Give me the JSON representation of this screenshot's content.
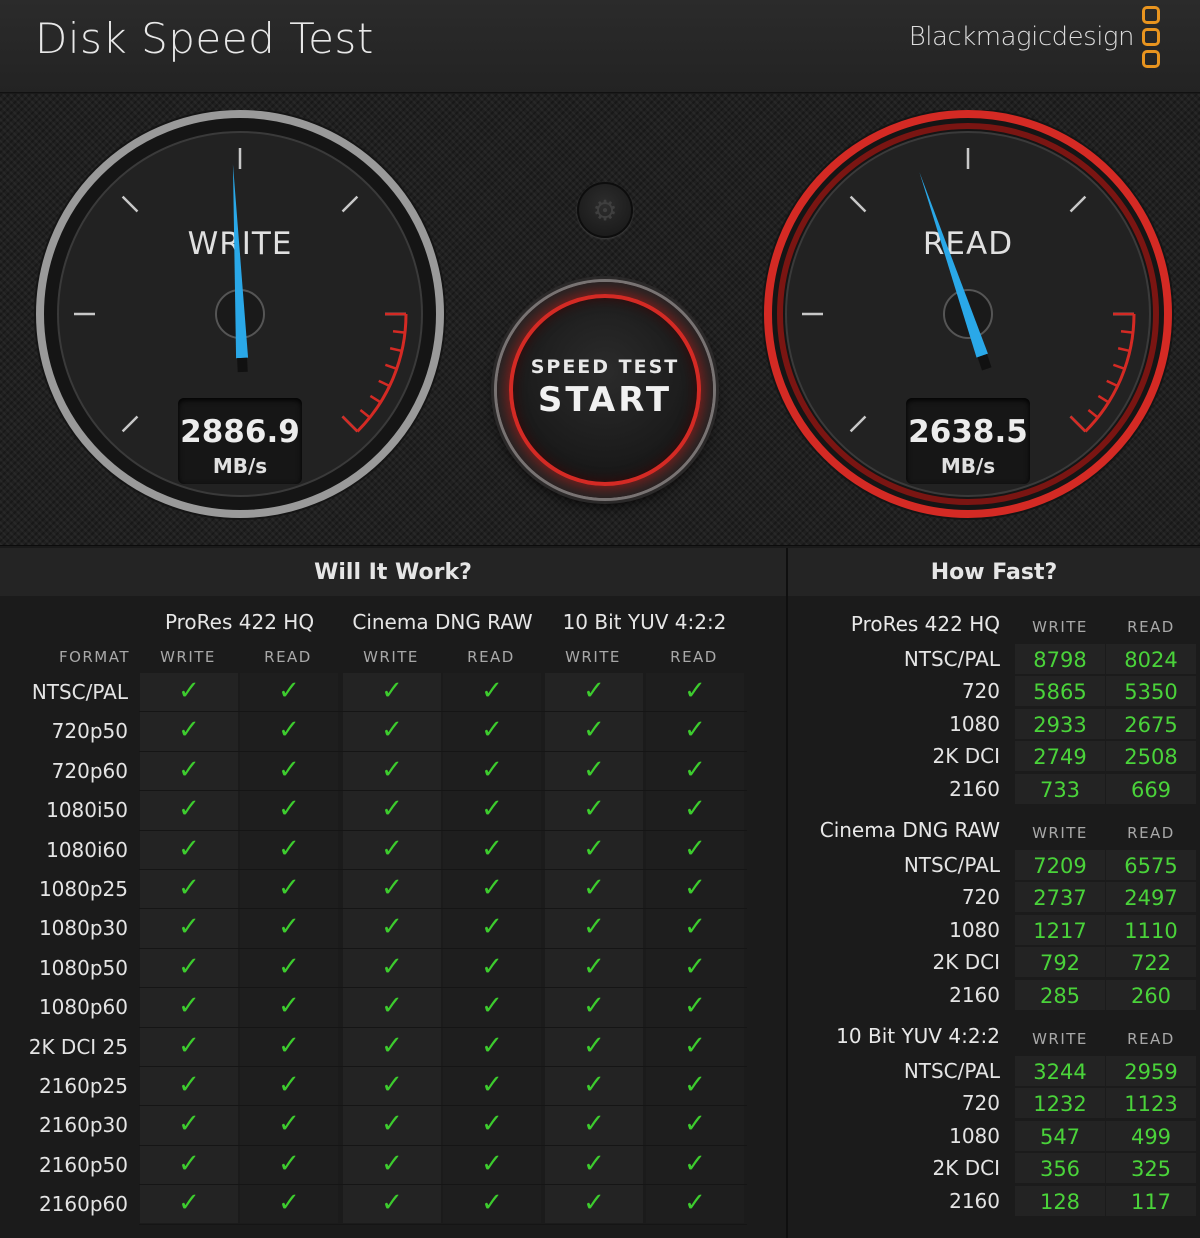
{
  "header": {
    "title": "Disk Speed Test",
    "brand": "Blackmagicdesign"
  },
  "gauges": {
    "write": {
      "label": "WRITE",
      "value": "2886.9",
      "unit": "MB/s",
      "needle_fraction": 0.49
    },
    "read": {
      "label": "READ",
      "value": "2638.5",
      "unit": "MB/s",
      "needle_fraction": 0.43
    },
    "accent_color": "#d42a24",
    "needle_color": "#2aa8e8"
  },
  "controls": {
    "settings_icon": "gear-icon",
    "start_small": "SPEED TEST",
    "start_big": "START"
  },
  "will_it_work": {
    "title": "Will It Work?",
    "format_header": "FORMAT",
    "groups": [
      {
        "name": "ProRes 422 HQ",
        "write": "WRITE",
        "read": "READ"
      },
      {
        "name": "Cinema DNG RAW",
        "write": "WRITE",
        "read": "READ"
      },
      {
        "name": "10 Bit YUV 4:2:2",
        "write": "WRITE",
        "read": "READ"
      }
    ],
    "formats": [
      "NTSC/PAL",
      "720p50",
      "720p60",
      "1080i50",
      "1080i60",
      "1080p25",
      "1080p30",
      "1080p50",
      "1080p60",
      "2K DCI 25",
      "2160p25",
      "2160p30",
      "2160p50",
      "2160p60"
    ],
    "check_mark": "✓",
    "check_color": "#3dcc2e"
  },
  "how_fast": {
    "title": "How Fast?",
    "write_header": "WRITE",
    "read_header": "READ",
    "groups": [
      {
        "name": "ProRes 422 HQ",
        "rows": [
          {
            "label": "NTSC/PAL",
            "write": "8798",
            "read": "8024"
          },
          {
            "label": "720",
            "write": "5865",
            "read": "5350"
          },
          {
            "label": "1080",
            "write": "2933",
            "read": "2675"
          },
          {
            "label": "2K DCI",
            "write": "2749",
            "read": "2508"
          },
          {
            "label": "2160",
            "write": "733",
            "read": "669"
          }
        ]
      },
      {
        "name": "Cinema DNG RAW",
        "rows": [
          {
            "label": "NTSC/PAL",
            "write": "7209",
            "read": "6575"
          },
          {
            "label": "720",
            "write": "2737",
            "read": "2497"
          },
          {
            "label": "1080",
            "write": "1217",
            "read": "1110"
          },
          {
            "label": "2K DCI",
            "write": "792",
            "read": "722"
          },
          {
            "label": "2160",
            "write": "285",
            "read": "260"
          }
        ]
      },
      {
        "name": "10 Bit YUV 4:2:2",
        "rows": [
          {
            "label": "NTSC/PAL",
            "write": "3244",
            "read": "2959"
          },
          {
            "label": "720",
            "write": "1232",
            "read": "1123"
          },
          {
            "label": "1080",
            "write": "547",
            "read": "499"
          },
          {
            "label": "2K DCI",
            "write": "356",
            "read": "325"
          },
          {
            "label": "2160",
            "write": "128",
            "read": "117"
          }
        ]
      }
    ],
    "value_color": "#4ad33a"
  }
}
